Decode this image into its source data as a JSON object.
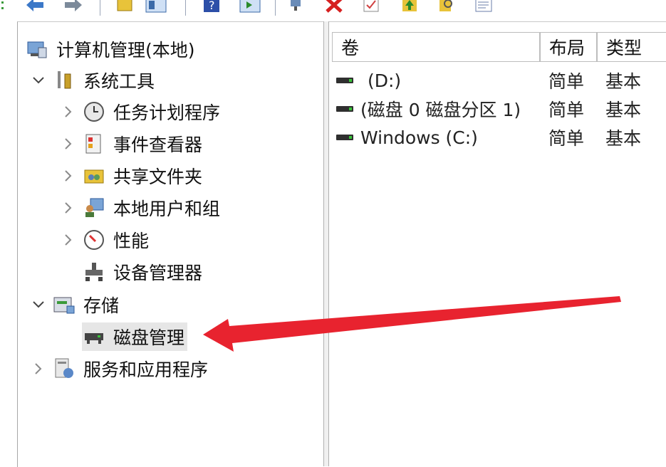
{
  "toolbar": {
    "buttons": [
      "back-icon",
      "forward-icon",
      "up-folder-icon",
      "show-hide-tree-icon",
      "help-icon",
      "show-hide-action-icon",
      "connect-icon",
      "delete-icon",
      "properties-icon",
      "import-icon",
      "find-icon",
      "export-icon"
    ]
  },
  "tree": {
    "root": {
      "label": "计算机管理(本地)",
      "icon": "computer-management-icon"
    },
    "items": [
      {
        "label": "系统工具",
        "icon": "system-tools-icon",
        "expanded": true
      },
      {
        "label": "任务计划程序",
        "icon": "task-scheduler-icon"
      },
      {
        "label": "事件查看器",
        "icon": "event-viewer-icon"
      },
      {
        "label": "共享文件夹",
        "icon": "shared-folders-icon"
      },
      {
        "label": "本地用户和组",
        "icon": "local-users-icon"
      },
      {
        "label": "性能",
        "icon": "performance-icon"
      },
      {
        "label": "设备管理器",
        "icon": "device-manager-icon"
      },
      {
        "label": "存储",
        "icon": "storage-icon",
        "expanded": true
      },
      {
        "label": "磁盘管理",
        "icon": "disk-management-icon",
        "selected": true
      },
      {
        "label": "服务和应用程序",
        "icon": "services-applications-icon"
      }
    ]
  },
  "volumes": {
    "columns": [
      "卷",
      "布局",
      "类型"
    ],
    "rows": [
      {
        "volume": "(D:)",
        "layout": "简单",
        "type": "基本"
      },
      {
        "volume": "(磁盘 0 磁盘分区 1)",
        "layout": "简单",
        "type": "基本"
      },
      {
        "volume": "Windows (C:)",
        "layout": "简单",
        "type": "基本"
      }
    ]
  },
  "annotation": {
    "color": "#e8232f"
  }
}
